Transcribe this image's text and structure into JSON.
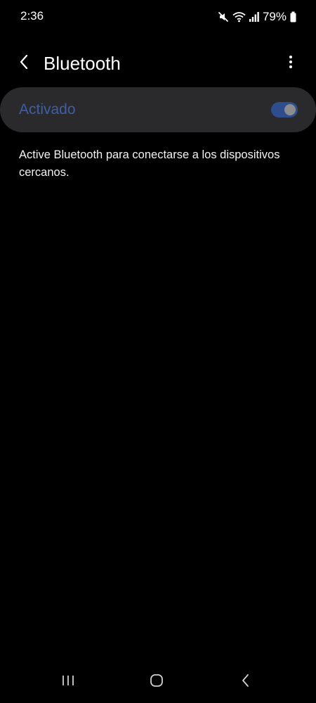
{
  "status_bar": {
    "time": "2:36",
    "battery": "79%",
    "icons": [
      "mute-icon",
      "wifi-icon",
      "signal-icon",
      "battery-icon"
    ]
  },
  "header": {
    "title": "Bluetooth",
    "back_icon": "chevron-left-icon",
    "more_icon": "more-vertical-icon"
  },
  "master_switch": {
    "label": "Activado",
    "on": true,
    "label_color": "#3d5fa8",
    "track_color": "#2e4d8c"
  },
  "description": "Active Bluetooth para conectarse a los dispositivos cercanos.",
  "nav_bar": {
    "icons": [
      "recents-icon",
      "home-icon",
      "back-icon"
    ]
  }
}
